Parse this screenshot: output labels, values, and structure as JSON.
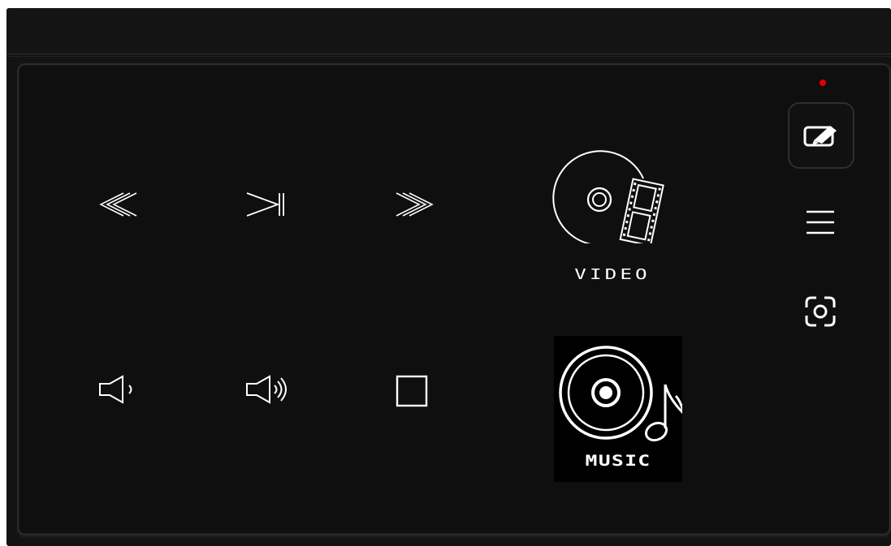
{
  "media": {
    "video_label": "VIDEO",
    "music_label": "MUSIC"
  },
  "controls": [
    {
      "name": "rewind-button",
      "icon": "rewind-icon"
    },
    {
      "name": "play-pause-button",
      "icon": "play-pause-icon"
    },
    {
      "name": "fast-forward-button",
      "icon": "fast-forward-icon"
    },
    {
      "name": "volume-down-button",
      "icon": "volume-down-icon"
    },
    {
      "name": "volume-up-button",
      "icon": "volume-up-icon"
    },
    {
      "name": "stop-button",
      "icon": "stop-icon"
    }
  ],
  "sidebar": {
    "items": [
      {
        "name": "draw-button",
        "icon": "pen-tablet-icon"
      },
      {
        "name": "menu-button",
        "icon": "hamburger-menu-icon"
      },
      {
        "name": "screenshot-button",
        "icon": "camera-focus-icon"
      }
    ],
    "status_indicator": "red-dot"
  },
  "colors": {
    "background": "#0f0f0f",
    "foreground": "#ffffff",
    "status": "#e30000"
  }
}
